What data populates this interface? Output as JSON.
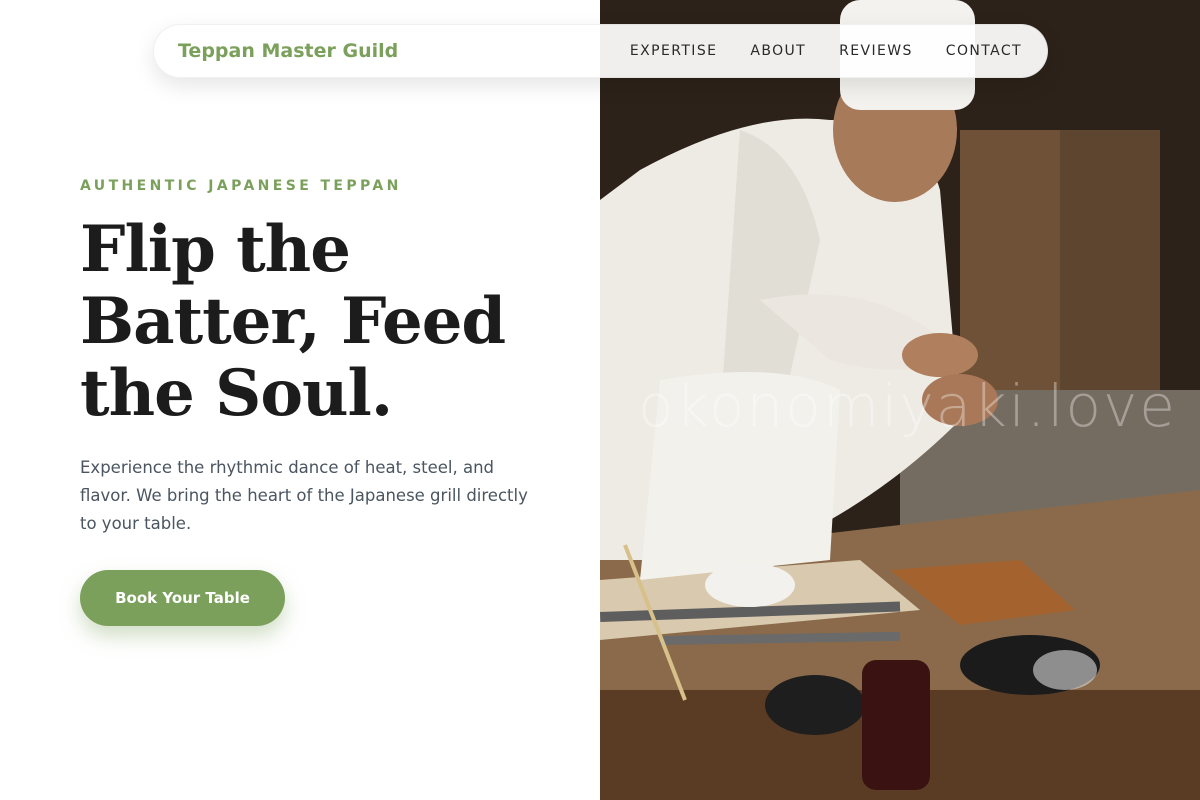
{
  "nav": {
    "brand": "Teppan Master Guild",
    "links": [
      "EXPERTISE",
      "ABOUT",
      "REVIEWS",
      "CONTACT"
    ]
  },
  "hero": {
    "eyebrow": "AUTHENTIC JAPANESE TEPPAN",
    "headline": "Flip the Batter, Feed the Soul.",
    "lede": "Experience the rhythmic dance of heat, steel, and flavor. We bring the heart of the Japanese grill directly to your table.",
    "cta_label": "Book Your Table",
    "photo_watermark": "okonomiyaki.love"
  },
  "colors": {
    "accent": "#7ba05b",
    "heading": "#1c1c1c",
    "body": "#4a5560"
  }
}
